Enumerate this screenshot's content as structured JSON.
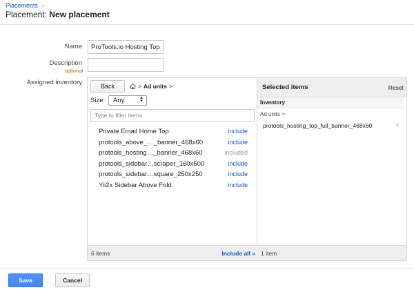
{
  "breadcrumb": {
    "label": "Placements",
    "separator": "›"
  },
  "page": {
    "title_prefix": "Placement:",
    "title_main": "New placement"
  },
  "form": {
    "name_label": "Name",
    "name_value": "ProTools.io Hosting Top Banner",
    "description_label": "Description",
    "description_optional": "optional",
    "description_value": "",
    "inventory_label": "Assigned inventory"
  },
  "browser": {
    "back_label": "Back",
    "crumb_home_icon": "home-icon",
    "crumb_gt1": ">",
    "crumb_current": "Ad units",
    "crumb_gt2": ">",
    "size_label": "Size:",
    "size_value": "Any",
    "filter_placeholder": "Type to filter items",
    "items": [
      {
        "name": "Private Email Home Top",
        "action": "include",
        "included": false
      },
      {
        "name": "protools_above_…_banner_468x60",
        "action": "include",
        "included": false
      },
      {
        "name": "protools_hosting…_banner_468x60",
        "action": "included",
        "included": true
      },
      {
        "name": "protools_sidebar…scraper_160x600",
        "action": "include",
        "included": false
      },
      {
        "name": "protools_sidebar…square_250x250",
        "action": "include",
        "included": false
      },
      {
        "name": "Yii2x Sidebar Above Fold",
        "action": "include",
        "included": false
      }
    ],
    "count_label": "6 items",
    "include_all_label": "Include all »"
  },
  "selected": {
    "title": "Selected items",
    "reset_label": "Reset",
    "inventory_heading": "Inventory",
    "ad_units_label": "Ad units >",
    "items": [
      {
        "name": "protools_hosting_top_full_banner_468x60"
      }
    ],
    "remove_glyph": "×",
    "count_label": "1 item"
  },
  "actions": {
    "save_label": "Save",
    "cancel_label": "Cancel"
  },
  "colors": {
    "link": "#1155cc",
    "primary": "#4d90fe",
    "optional": "#a56b00"
  }
}
